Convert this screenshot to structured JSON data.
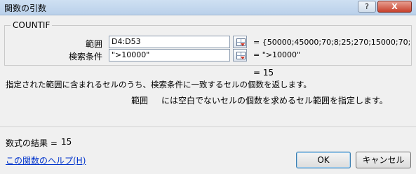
{
  "window": {
    "title": "関数の引数",
    "help_button": "?",
    "close_button": "X"
  },
  "function": {
    "name": "COUNTIF",
    "args": [
      {
        "label": "範囲",
        "value": "D4:D53",
        "result": "= {50000;45000;70;8;25;270;15000;70;100..."
      },
      {
        "label": "検索条件",
        "value": "\">10000\"",
        "result": "= \">10000\""
      }
    ],
    "result_preview": "=  15",
    "description": "指定された範囲に含まれるセルのうち、検索条件に一致するセルの個数を返します。",
    "arg_help_name": "範囲",
    "arg_help_text": "には空白でないセルの個数を求めるセル範囲を指定します。"
  },
  "formula_result": {
    "label": "数式の結果 =",
    "value": "15"
  },
  "footer": {
    "help_link": "この関数のヘルプ(H)",
    "ok": "OK",
    "cancel": "キャンセル"
  }
}
